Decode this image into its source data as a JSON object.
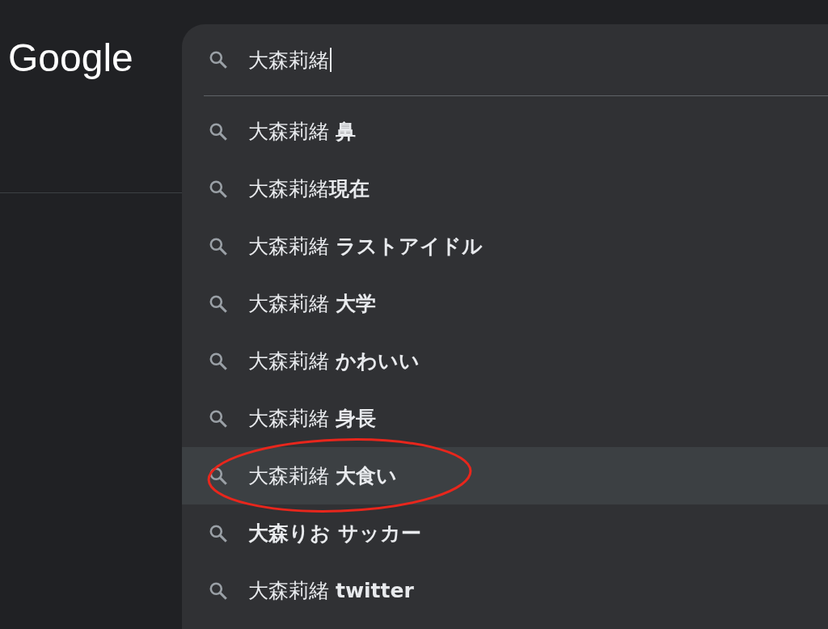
{
  "logo": "Google",
  "search": {
    "value": "大森莉緒"
  },
  "suggestions": [
    {
      "text": "大森莉緒 **鼻**",
      "bold": false,
      "selected": false
    },
    {
      "text": "大森莉緒**現在**",
      "bold": false,
      "selected": false
    },
    {
      "text": "大森莉緒 **ラストアイドル**",
      "bold": false,
      "selected": false
    },
    {
      "text": "大森莉緒 **大学**",
      "bold": false,
      "selected": false
    },
    {
      "text": "大森莉緒 **かわいい**",
      "bold": false,
      "selected": false
    },
    {
      "text": "大森莉緒 **身長**",
      "bold": false,
      "selected": false
    },
    {
      "text": "大森莉緒 **大食い**",
      "bold": false,
      "selected": true
    },
    {
      "text": "大森りお サッカー",
      "bold": true,
      "selected": false
    },
    {
      "text": "大森莉緒 **twitter**",
      "bold": false,
      "selected": false
    }
  ]
}
